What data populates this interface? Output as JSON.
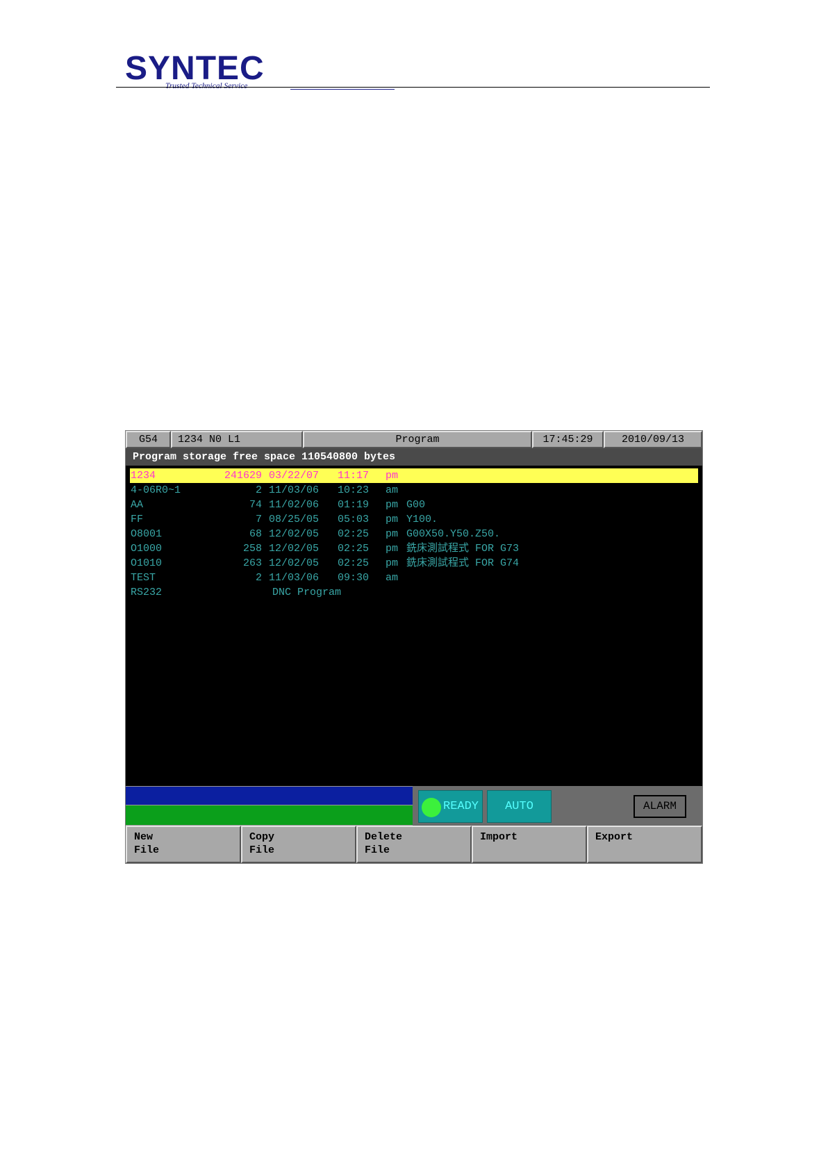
{
  "header": {
    "logo_text": "SYNTEC",
    "logo_tagline": "Trusted Technical Service"
  },
  "screen": {
    "topbar": {
      "coord": "G54",
      "program_line": "1234 N0 L1",
      "title": "Program",
      "time": "17:45:29",
      "date": "2010/09/13"
    },
    "free_space": "Program storage free space 110540800 bytes",
    "files": [
      {
        "name": "1234",
        "size": "241629",
        "date": "03/22/07",
        "time": "11:17",
        "ampm": "pm",
        "comment": "",
        "selected": true
      },
      {
        "name": "4-06R0~1",
        "size": "2",
        "date": "11/03/06",
        "time": "10:23",
        "ampm": "am",
        "comment": ""
      },
      {
        "name": "AA",
        "size": "74",
        "date": "11/02/06",
        "time": "01:19",
        "ampm": "pm",
        "comment": "G00"
      },
      {
        "name": "FF",
        "size": "7",
        "date": "08/25/05",
        "time": "05:03",
        "ampm": "pm",
        "comment": "Y100."
      },
      {
        "name": "O8001",
        "size": "68",
        "date": "12/02/05",
        "time": "02:25",
        "ampm": "pm",
        "comment": "G00X50.Y50.Z50."
      },
      {
        "name": "O1000",
        "size": "258",
        "date": "12/02/05",
        "time": "02:25",
        "ampm": "pm",
        "comment": "銑床測試程式 FOR G73"
      },
      {
        "name": "O1010",
        "size": "263",
        "date": "12/02/05",
        "time": "02:25",
        "ampm": "pm",
        "comment": "銑床測試程式 FOR G74"
      },
      {
        "name": "TEST",
        "size": "2",
        "date": "11/03/06",
        "time": "09:30",
        "ampm": "am",
        "comment": ""
      }
    ],
    "dnc": {
      "name": "RS232",
      "label": "DNC Program"
    },
    "status": {
      "ready_label": "READY",
      "auto_label": "AUTO",
      "alarm_label": "ALARM"
    },
    "softkeys": [
      "New\nFile",
      "Copy\nFile",
      "Delete\nFile",
      "Import",
      "Export"
    ]
  }
}
